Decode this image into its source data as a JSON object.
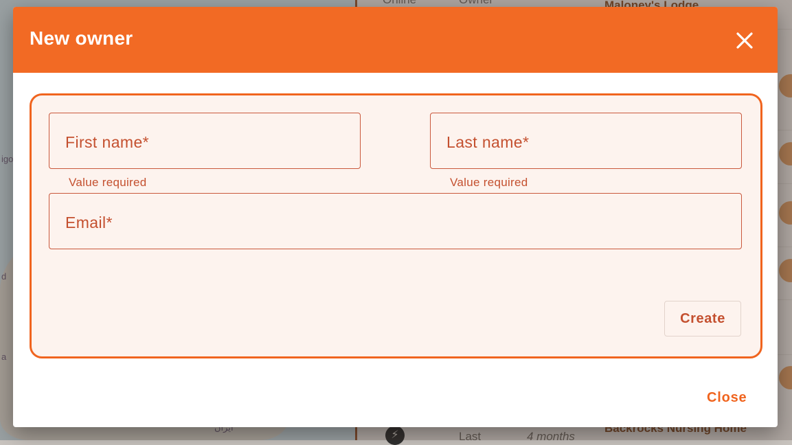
{
  "background": {
    "map_labels": [
      "igo",
      "d",
      "a",
      "ايران"
    ],
    "list_fragments": [
      "Online",
      "Owner",
      "Maloney's Lodge",
      "Backrocks Nursing Home",
      "Last",
      "4 months"
    ]
  },
  "dialog": {
    "title": "New owner",
    "close_icon": "close-icon",
    "form": {
      "first_name": {
        "label": "First name*",
        "value": "",
        "helper": "Value required"
      },
      "last_name": {
        "label": "Last name*",
        "value": "",
        "helper": "Value required"
      },
      "email": {
        "label": "Email*",
        "value": ""
      },
      "create_label": "Create"
    },
    "close_label": "Close"
  },
  "colors": {
    "accent": "#f26a24",
    "error": "#c4502f",
    "form_bg": "#fdf3ee"
  }
}
